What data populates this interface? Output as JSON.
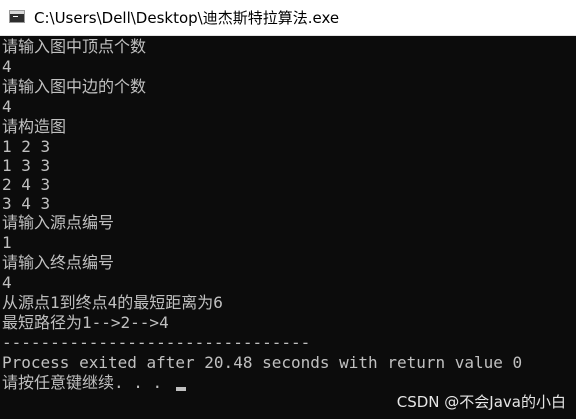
{
  "window": {
    "title": "C:\\Users\\Dell\\Desktop\\迪杰斯特拉算法.exe",
    "icon": "console-app-icon"
  },
  "console": {
    "lines": [
      "请输入图中顶点个数",
      "4",
      "请输入图中边的个数",
      "4",
      "请构造图",
      "1 2 3",
      "1 3 3",
      "2 4 3",
      "3 4 3",
      "请输入源点编号",
      "1",
      "请输入终点编号",
      "4",
      "从源点1到终点4的最短距离为6",
      "最短路径为1-->2-->4",
      "--------------------------------",
      "Process exited after 20.48 seconds with return value 0",
      "请按任意键继续. . . "
    ]
  },
  "watermark": "CSDN @不会Java的小白",
  "colors": {
    "console_bg": "#0c0c0c",
    "console_text": "#c0c0c0",
    "titlebar_bg": "#ffffff"
  }
}
